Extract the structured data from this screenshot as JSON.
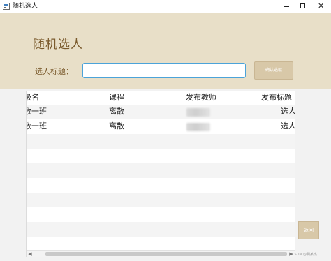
{
  "window": {
    "title": "随机选人",
    "min_glyph": "",
    "max_glyph": "",
    "close_glyph": "✕"
  },
  "header": {
    "page_title": "随机选人",
    "title_label": "选人标题：",
    "title_input_value": "",
    "confirm_button": "确认选取"
  },
  "table": {
    "columns": [
      "级名",
      "课程",
      "发布教师",
      "发布标题"
    ],
    "rows": [
      {
        "class": "数一班",
        "course": "离散",
        "teacher": "",
        "title": "选人"
      },
      {
        "class": "数一班",
        "course": "离散",
        "teacher": "",
        "title": "选人"
      }
    ]
  },
  "scrollbar": {
    "left_arrow": "◀",
    "right_arrow": "▶"
  },
  "back_button": "返回",
  "watermark": "CSDN @明某杰",
  "colors": {
    "header_bg": "#e8dfc8",
    "accent_text": "#7a5a2c",
    "button_bg": "#d8c8a8",
    "input_border": "#4ba3d9"
  }
}
